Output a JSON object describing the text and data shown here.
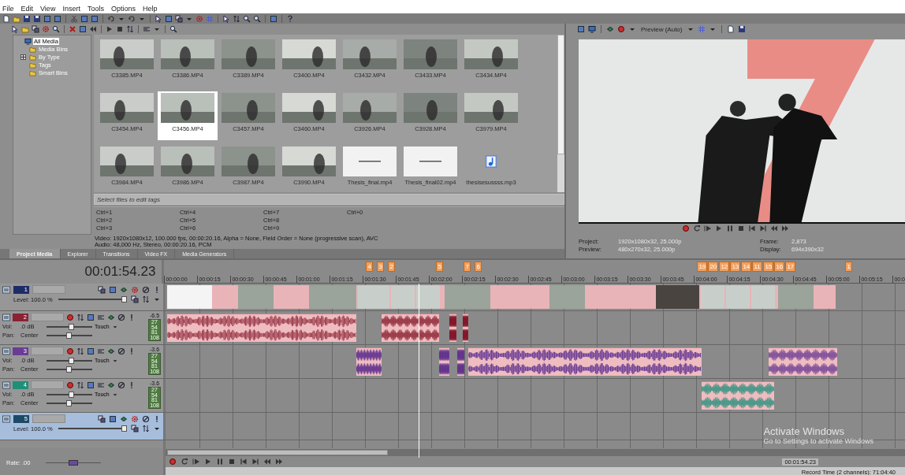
{
  "menu": [
    "File",
    "Edit",
    "View",
    "Insert",
    "Tools",
    "Options",
    "Help"
  ],
  "media_tree": [
    {
      "label": "All Media",
      "selected": true,
      "collapsed": false
    },
    {
      "label": "Media Bins",
      "selected": false,
      "collapsed": false
    },
    {
      "label": "By Type",
      "selected": false,
      "collapsed": true
    },
    {
      "label": "Tags",
      "selected": false,
      "collapsed": false
    },
    {
      "label": "Smart Bins",
      "selected": false,
      "collapsed": false
    }
  ],
  "media_items": [
    {
      "name": "C3385.MP4",
      "kind": "video",
      "selected": false
    },
    {
      "name": "C3386.MP4",
      "kind": "video",
      "selected": false
    },
    {
      "name": "C3389.MP4",
      "kind": "video",
      "selected": false
    },
    {
      "name": "C3400.MP4",
      "kind": "video",
      "selected": false
    },
    {
      "name": "C3432.MP4",
      "kind": "video",
      "selected": false
    },
    {
      "name": "C3433.MP4",
      "kind": "video",
      "selected": false
    },
    {
      "name": "C3434.MP4",
      "kind": "video",
      "selected": false
    },
    {
      "name": "C3454.MP4",
      "kind": "video",
      "selected": false
    },
    {
      "name": "C3456.MP4",
      "kind": "video",
      "selected": true
    },
    {
      "name": "C3457.MP4",
      "kind": "video",
      "selected": false
    },
    {
      "name": "C3460.MP4",
      "kind": "video",
      "selected": false
    },
    {
      "name": "C3926.MP4",
      "kind": "video",
      "selected": false
    },
    {
      "name": "C3928.MP4",
      "kind": "video",
      "selected": false
    },
    {
      "name": "C3979.MP4",
      "kind": "video",
      "selected": false
    },
    {
      "name": "C3984.MP4",
      "kind": "video",
      "selected": false
    },
    {
      "name": "C3986.MP4",
      "kind": "video",
      "selected": false
    },
    {
      "name": "C3987.MP4",
      "kind": "video",
      "selected": false
    },
    {
      "name": "C3990.MP4",
      "kind": "video",
      "selected": false
    },
    {
      "name": "Thesis_final.mp4",
      "kind": "title",
      "selected": false
    },
    {
      "name": "Thesis_final02.mp4",
      "kind": "title",
      "selected": false
    },
    {
      "name": "thesisesussss.mp3",
      "kind": "audio",
      "selected": false
    }
  ],
  "tags_field": {
    "placeholder": "Select files to edit tags"
  },
  "shortcuts": [
    [
      "Ctrl+1",
      "Ctrl+2",
      "Ctrl+3"
    ],
    [
      "Ctrl+4",
      "Ctrl+5",
      "Ctrl+6"
    ],
    [
      "Ctrl+7",
      "Ctrl+8",
      "Ctrl+9"
    ],
    [
      "Ctrl+0"
    ]
  ],
  "media_info": [
    "Video: 1920x1080x12, 100.000 fps, 00:00:20.16, Alpha = None, Field Order = None (progressive scan), AVC",
    "Audio: 48,000 Hz, Stereo, 00:00:20.16, PCM"
  ],
  "media_tabs": [
    {
      "label": "Project Media",
      "selected": true
    },
    {
      "label": "Explorer",
      "selected": false
    },
    {
      "label": "Transitions",
      "selected": false
    },
    {
      "label": "Video FX",
      "selected": false
    },
    {
      "label": "Media Generators",
      "selected": false
    }
  ],
  "preview": {
    "quality": "Preview (Auto)",
    "project_label": "Project:",
    "project": "1920x1080x32, 25.000p",
    "preview_label": "Preview:",
    "preview": "480x270x32, 25.000p",
    "frame_label": "Frame:",
    "frame": "2,873",
    "display_label": "Display:",
    "display": "694x390x32"
  },
  "timeline": {
    "time": "00:01:54.23",
    "ruler": [
      "00:00:00",
      "00:00:15",
      "00:00:30",
      "00:00:45",
      "00:01:00",
      "00:01:15",
      "00:01:30",
      "00:01:45",
      "00:02:00",
      "00:02:15",
      "00:02:30",
      "00:02:45",
      "00:03:00",
      "00:03:15",
      "00:03:30",
      "00:03:45",
      "00:04:00",
      "00:04:15",
      "00:04:30",
      "00:04:45",
      "00:05:00",
      "00:05:15",
      "00:0"
    ],
    "markers": [
      "4",
      "3",
      "2",
      "5",
      "7",
      "6",
      "19",
      "20",
      "12",
      "13",
      "14",
      "11",
      "15",
      "16",
      "17",
      "1"
    ],
    "tracks": [
      {
        "kind": "video",
        "number": "1",
        "color": "#1c2c66",
        "level_text": "Level: 100.0 %",
        "level": 1.0,
        "selected": false
      },
      {
        "kind": "audio",
        "number": "2",
        "color": "#8a2234",
        "vol_label": "Vol:",
        "volume": {
          "text": ".0 dB",
          "level": 0.55
        },
        "pan_label": "Pan:",
        "pan": {
          "text": "Center",
          "level": 0.5
        },
        "mode": "Touch",
        "peak": "-6.5",
        "meter_marks": [
          "27",
          "54",
          "81",
          "108"
        ],
        "selected": false
      },
      {
        "kind": "audio",
        "number": "3",
        "color": "#6a3c94",
        "vol_label": "Vol:",
        "volume": {
          "text": ".0 dB",
          "level": 0.55
        },
        "pan_label": "Pan:",
        "pan": {
          "text": "Center",
          "level": 0.5
        },
        "mode": "Touch",
        "peak": "-3.6",
        "meter_marks": [
          "27",
          "54",
          "81",
          "108"
        ],
        "selected": false
      },
      {
        "kind": "audio",
        "number": "4",
        "color": "#1f8f78",
        "vol_label": "Vol:",
        "volume": {
          "text": ".0 dB",
          "level": 0.55
        },
        "pan_label": "Pan:",
        "pan": {
          "text": "Center",
          "level": 0.5
        },
        "mode": "Touch",
        "peak": "-3.6",
        "meter_marks": [
          "27",
          "54",
          "81",
          "108"
        ],
        "selected": false
      },
      {
        "kind": "video",
        "number": "5",
        "color": "#1c4a66",
        "level_text": "Level: 100.0 %",
        "level": 1.0,
        "selected": true
      }
    ]
  },
  "bottom": {
    "rate": {
      "text": "Rate: .00",
      "level": 0.5
    },
    "time": "00:01:54.23",
    "record_time": "Record Time (2 channels): 71:04:40"
  },
  "os_notice": {
    "title": "Activate Windows",
    "detail": "Go to Settings to activate Windows"
  }
}
